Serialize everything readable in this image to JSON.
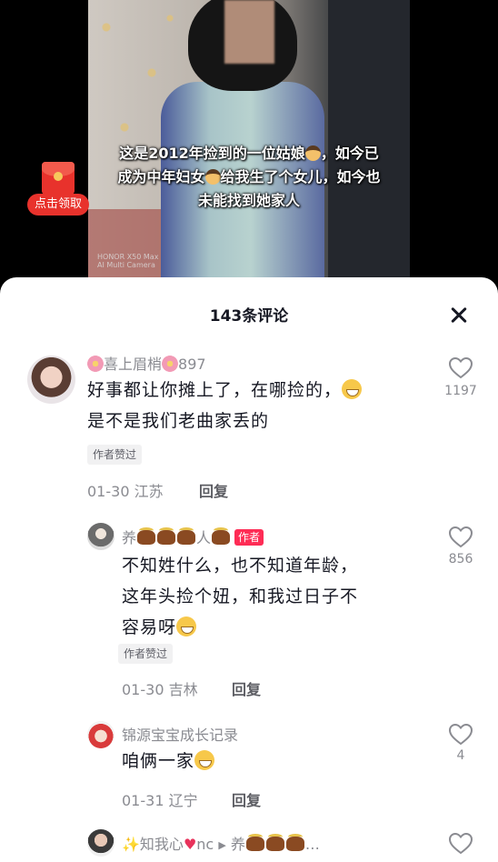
{
  "video": {
    "caption_line1": "这是2012年捡到的一位姑娘",
    "caption_line1b": "，如今已",
    "caption_line2": "成为中年妇女",
    "caption_line2b": "给我生了个女儿，如今也",
    "caption_line3": "未能找到她家人",
    "watermark_line1": "HONOR X50 Max",
    "watermark_line2": "AI Multi Camera"
  },
  "redpacket": {
    "label": "点击领取"
  },
  "sheet": {
    "title": "143条评论"
  },
  "comments": [
    {
      "username_pre": "喜上眉梢",
      "username_post": "897",
      "text_line1": "好事都让你摊上了，在哪捡的，",
      "text_line2": "是不是我们老曲家丢的",
      "tag": "作者赞过",
      "date": "01-30",
      "location": "江苏",
      "reply": "回复",
      "likes": "1197"
    },
    {
      "username_pre": "养",
      "username_mid": "人",
      "author_badge": "作者",
      "text_line1": "不知姓什么，也不知道年龄，",
      "text_line2": "这年头捡个妞，和我过日子不",
      "text_line3": "容易呀",
      "tag": "作者赞过",
      "date": "01-30",
      "location": "吉林",
      "reply": "回复",
      "likes": "856"
    },
    {
      "username": "锦源宝宝成长记录",
      "text": "咱俩一家",
      "date": "01-31",
      "location": "辽宁",
      "reply": "回复",
      "likes": "4"
    },
    {
      "username_a": "知我心",
      "username_a_suffix": "nc",
      "username_b": "养",
      "username_b_suffix": "…"
    }
  ],
  "colors": {
    "brand_red": "#fe2c55",
    "text_primary": "#161823",
    "text_secondary": "#8a8b91"
  }
}
